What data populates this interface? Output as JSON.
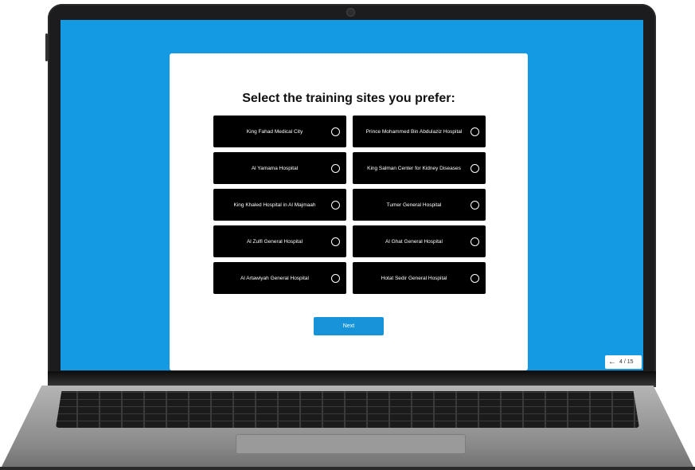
{
  "dialog": {
    "title": "Select the training sites you prefer:",
    "options": [
      {
        "label": "King Fahad Medical City",
        "selected": false
      },
      {
        "label": "Prince Mohammed Bin Abdulaziz Hospital",
        "selected": false
      },
      {
        "label": "Al Yamama Hospital",
        "selected": false
      },
      {
        "label": "King Salman Center for Kidney Diseases",
        "selected": false
      },
      {
        "label": "King Khaled Hospital in Al Majmaah",
        "selected": false
      },
      {
        "label": "Tumer General Hospital",
        "selected": false
      },
      {
        "label": "Al Zulfi General Hospital",
        "selected": false
      },
      {
        "label": "Al Ghat General Hospital",
        "selected": false
      },
      {
        "label": "Al Artawiyah General Hospital",
        "selected": false
      },
      {
        "label": "Hotat Sedir General Hospital",
        "selected": false
      }
    ],
    "next_label": "Next"
  },
  "pager": {
    "back_icon": "arrow-left-icon",
    "text": "4 / 15"
  },
  "colors": {
    "screen_background": "#139ae3",
    "option_background": "#000000",
    "button_background": "#1693d9"
  }
}
